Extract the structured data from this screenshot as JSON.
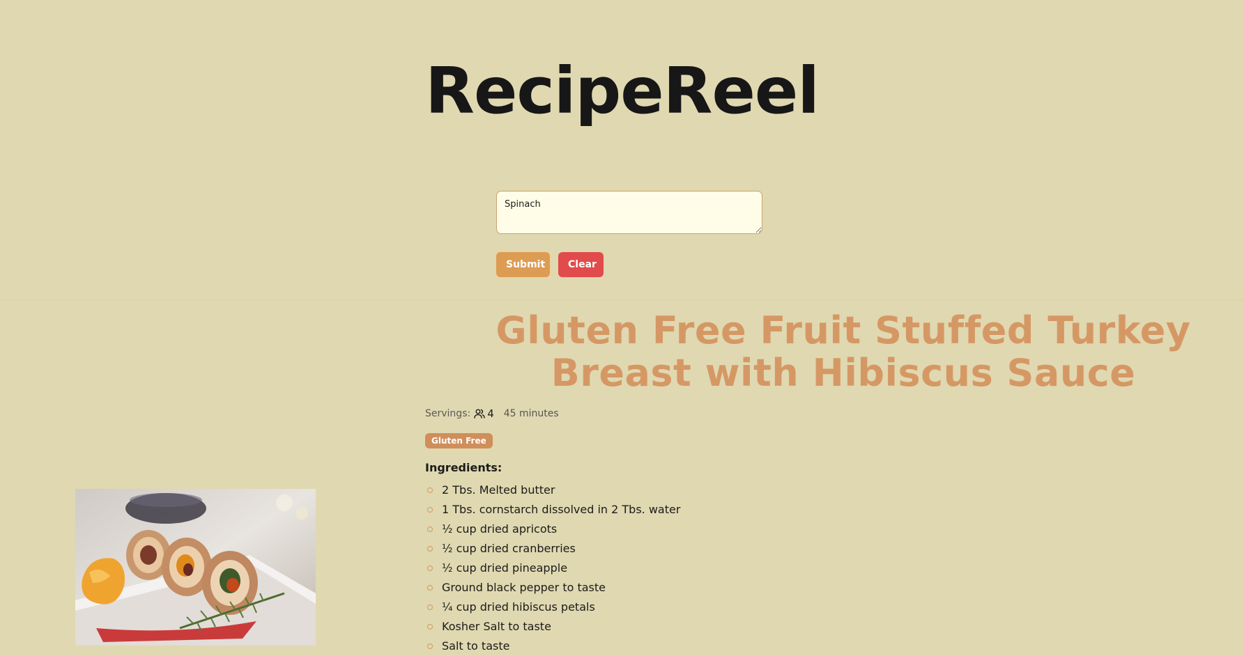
{
  "app": {
    "title": "RecipeReel"
  },
  "search": {
    "value": "Spinach",
    "placeholder": ""
  },
  "buttons": {
    "submit_label": "Submit",
    "clear_label": "Clear"
  },
  "recipe": {
    "title": "Gluten Free Fruit Stuffed Turkey Breast with Hibiscus Sauce",
    "servings_label": "Servings:",
    "servings_value": "4",
    "time": "45 minutes",
    "tags": [
      "Gluten Free"
    ],
    "ingredients_heading": "Ingredients:",
    "ingredients": [
      "2 Tbs. Melted butter",
      "1 Tbs. cornstarch dissolved in 2 Tbs. water",
      "½ cup dried apricots",
      "½ cup dried cranberries",
      "½ cup dried pineapple",
      "Ground black pepper to taste",
      "¼ cup dried hibiscus petals",
      "Kosher Salt to taste",
      "Salt to taste"
    ]
  },
  "colors": {
    "background": "#e0d8b0",
    "accent": "#d59865",
    "submit": "#dd9c53",
    "clear": "#e14b4b"
  },
  "icons": {
    "servings": "users-icon"
  }
}
